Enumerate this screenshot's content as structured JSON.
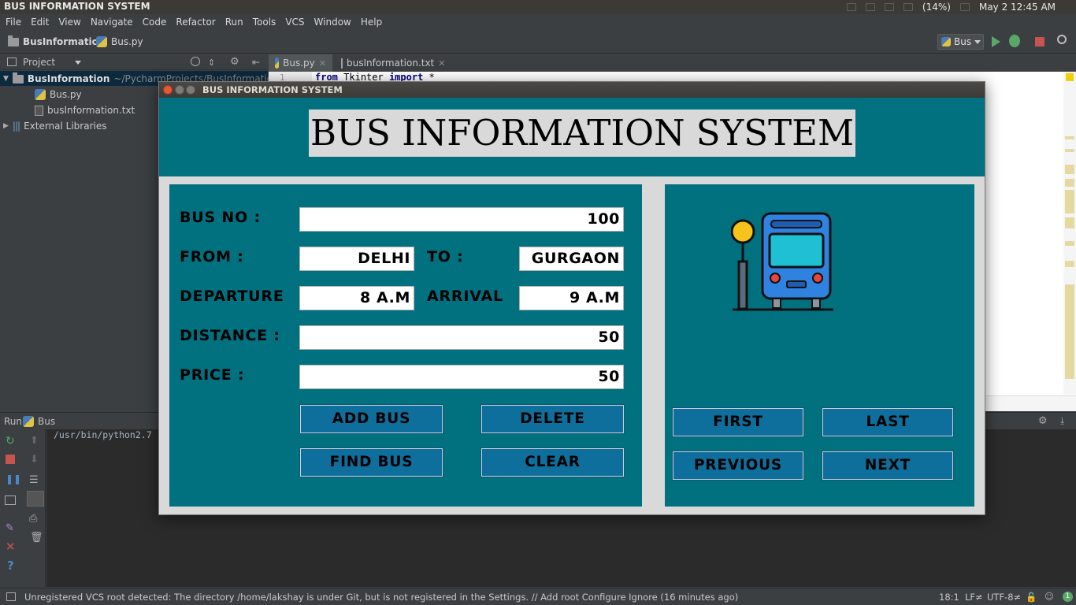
{
  "topbar": {
    "title": "BUS INFORMATION SYSTEM",
    "battery": "(14%)",
    "clock": "May 2 12:45 AM"
  },
  "menu": [
    "File",
    "Edit",
    "View",
    "Navigate",
    "Code",
    "Refactor",
    "Run",
    "Tools",
    "VCS",
    "Window",
    "Help"
  ],
  "nav": {
    "project": "BusInformation",
    "file": "Bus.py",
    "run_config": "Bus"
  },
  "project_panel": {
    "header": "Project",
    "root": "BusInformation",
    "root_path": "~/PycharmProjects/BusInformation",
    "files": [
      "Bus.py",
      "busInformation.txt"
    ],
    "external": "External Libraries"
  },
  "editor": {
    "tabs": [
      "Bus.py",
      "busInformation.txt"
    ],
    "line_number": "1",
    "code": {
      "kw1": "from",
      "mod": "Tkinter",
      "kw2": "import",
      "star": "*"
    }
  },
  "run_panel": {
    "label": "Run",
    "config": "Bus",
    "console": "/usr/bin/python2.7"
  },
  "status": {
    "message": "Unregistered VCS root detected: The directory /home/lakshay is under Git, but is not registered in the Settings. // Add root  Configure  Ignore (16 minutes ago)",
    "position": "18:1",
    "line_sep": "LF≠",
    "encoding": "UTF-8≠"
  },
  "app": {
    "window_title": "BUS INFORMATION SYSTEM",
    "main_title": "BUS INFORMATION SYSTEM",
    "labels": {
      "bus_no": "BUS NO :",
      "from": "FROM :",
      "to": "TO :",
      "departure": "DEPARTURE",
      "arrival": "ARRIVAL",
      "distance": "DISTANCE :",
      "price": "PRICE :"
    },
    "values": {
      "bus_no": "100",
      "from": "DELHI",
      "to": "GURGAON",
      "departure": "8 A.M",
      "arrival": "9 A.M",
      "distance": "50",
      "price": "50"
    },
    "buttons": {
      "add": "ADD BUS",
      "delete": "DELETE",
      "find": "FIND BUS",
      "clear": "CLEAR",
      "first": "FIRST",
      "last": "LAST",
      "previous": "PREVIOUS",
      "next": "NEXT"
    },
    "colors": {
      "panel": "#01707f",
      "button": "#0e6f9d",
      "bg": "#d9d9d9"
    }
  }
}
